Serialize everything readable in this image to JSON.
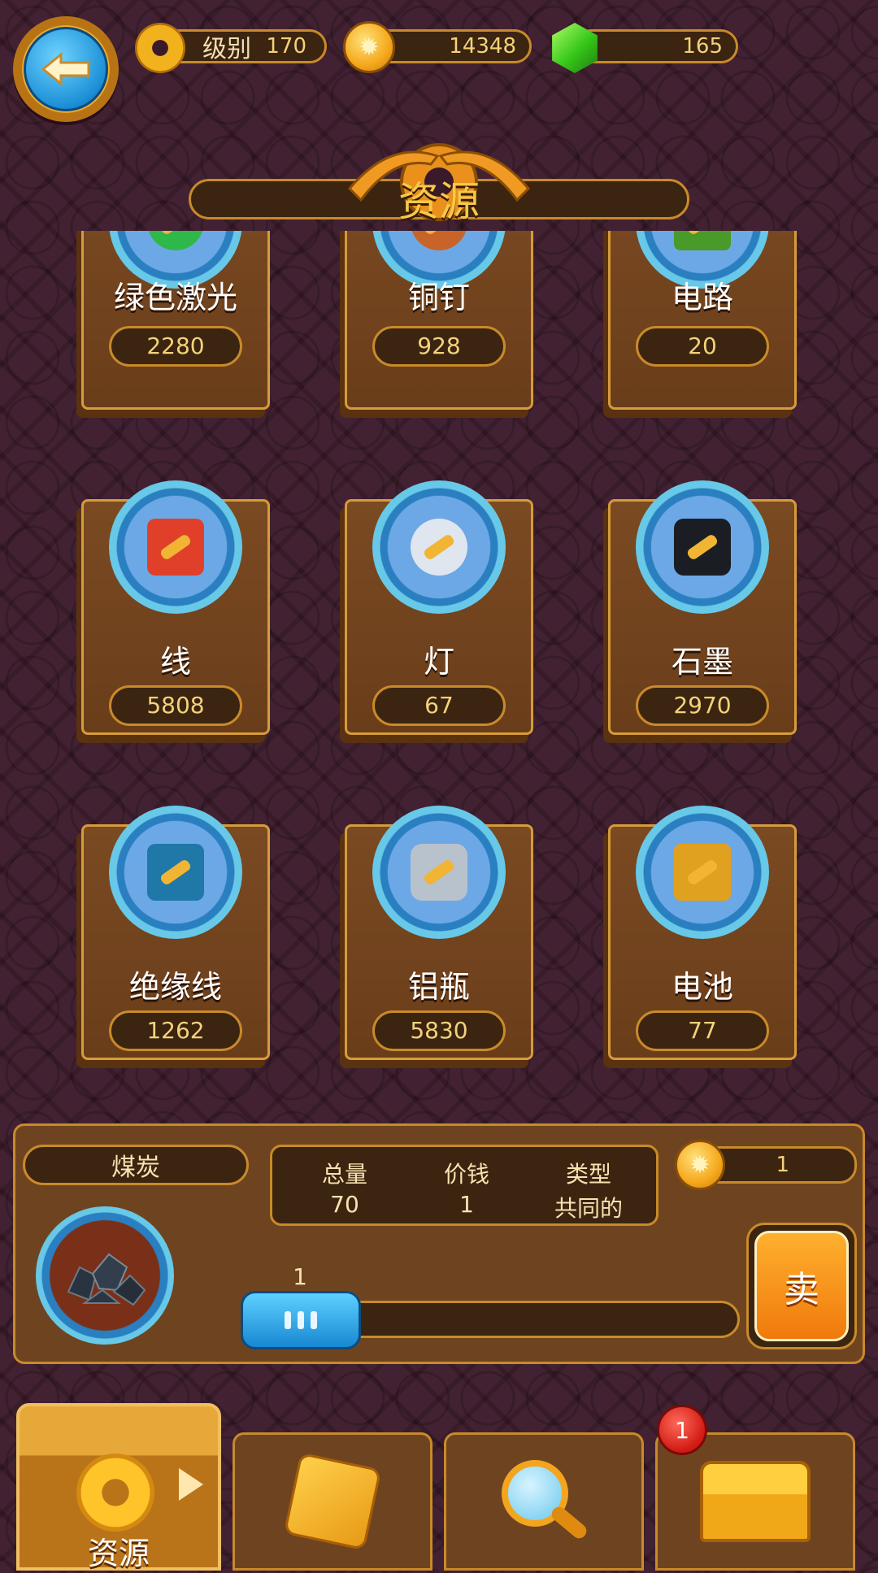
{
  "header": {
    "level_label": "级别",
    "level_value": "170",
    "coins_value": "14348",
    "gems_value": "165"
  },
  "title": "资源",
  "resources": [
    {
      "name": "绿色激光",
      "count": "2280",
      "icon": "green-laser-icon"
    },
    {
      "name": "铜钉",
      "count": "928",
      "icon": "copper-nail-icon"
    },
    {
      "name": "电路",
      "count": "20",
      "icon": "circuit-icon"
    },
    {
      "name": "线",
      "count": "5808",
      "icon": "thread-spool-icon"
    },
    {
      "name": "灯",
      "count": "67",
      "icon": "lightbulb-icon"
    },
    {
      "name": "石墨",
      "count": "2970",
      "icon": "graphite-icon"
    },
    {
      "name": "绝缘线",
      "count": "1262",
      "icon": "insulated-wire-icon"
    },
    {
      "name": "铝瓶",
      "count": "5830",
      "icon": "aluminum-bottle-icon"
    },
    {
      "name": "电池",
      "count": "77",
      "icon": "battery-icon"
    }
  ],
  "detail": {
    "name": "煤炭",
    "icon": "coal-icon",
    "stats": [
      {
        "label": "总量",
        "value": "70"
      },
      {
        "label": "价钱",
        "value": "1"
      },
      {
        "label": "类型",
        "value": "共同的"
      }
    ],
    "coin_amount": "1",
    "slider_value": "1",
    "sell_label": "卖"
  },
  "tabs": [
    {
      "label": "资源",
      "icon": "gear-icon",
      "active": true
    },
    {
      "label": "",
      "icon": "dice-icon",
      "active": false
    },
    {
      "label": "",
      "icon": "magnifier-icon",
      "active": false
    },
    {
      "label": "",
      "icon": "chest-icon",
      "active": false,
      "badge": "1"
    }
  ],
  "colors": {
    "accent_gold": "#f7c948",
    "panel_brown": "#6e4420",
    "border_gold": "#c88a2a",
    "background": "#3a1a2a"
  }
}
